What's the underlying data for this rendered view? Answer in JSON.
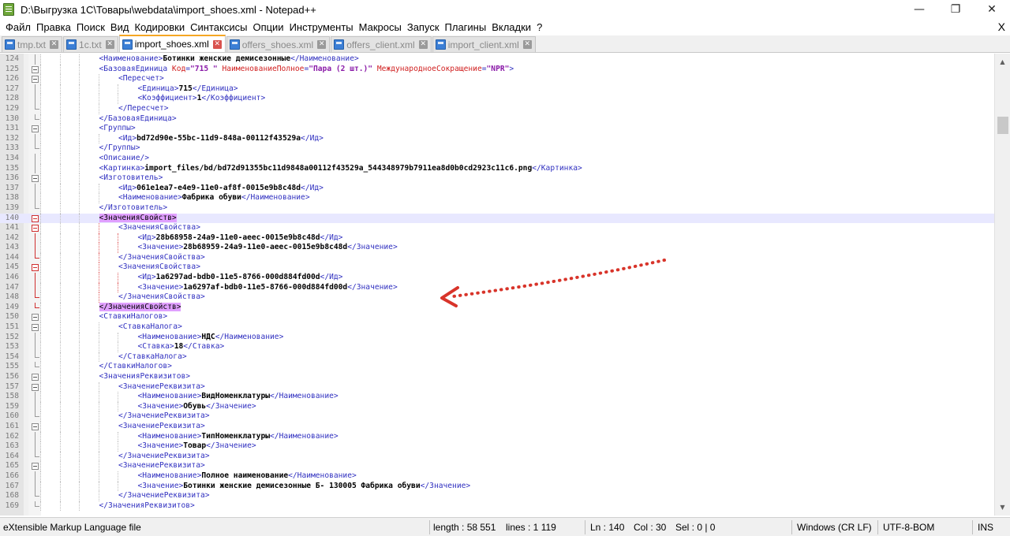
{
  "window": {
    "title": "D:\\Выгрузка 1С\\Товары\\webdata\\import_shoes.xml - Notepad++",
    "minimize": "—",
    "maximize": "❐",
    "close": "✕"
  },
  "menu": {
    "items": [
      "Файл",
      "Правка",
      "Поиск",
      "Вид",
      "Кодировки",
      "Синтаксисы",
      "Опции",
      "Инструменты",
      "Макросы",
      "Запуск",
      "Плагины",
      "Вкладки",
      "?"
    ],
    "close": "X"
  },
  "tabs": [
    {
      "label": "tmp.txt",
      "active": false
    },
    {
      "label": "1c.txt",
      "active": false
    },
    {
      "label": "import_shoes.xml",
      "active": true
    },
    {
      "label": "offers_shoes.xml",
      "active": false
    },
    {
      "label": "offers_client.xml",
      "active": false
    },
    {
      "label": "import_client.xml",
      "active": false
    }
  ],
  "editor": {
    "current_line": 140,
    "lines": [
      {
        "n": "124",
        "level": 4,
        "fold": "line",
        "parts": [
          [
            "tag",
            "<Наименование>"
          ],
          [
            "txt",
            "Ботинки женские демисезонные"
          ],
          [
            "tag",
            "</Наименование>"
          ]
        ]
      },
      {
        "n": "125",
        "level": 4,
        "fold": "box",
        "parts": [
          [
            "tag",
            "<БазоваяЕдиница "
          ],
          [
            "attr",
            "Код"
          ],
          [
            "tag",
            "="
          ],
          [
            "val",
            "\"715 \""
          ],
          [
            "tag",
            " "
          ],
          [
            "attr",
            "НаименованиеПолное"
          ],
          [
            "tag",
            "="
          ],
          [
            "val",
            "\"Пара (2 шт.)\""
          ],
          [
            "tag",
            " "
          ],
          [
            "attr",
            "МеждународноеСокращение"
          ],
          [
            "tag",
            "="
          ],
          [
            "val",
            "\"NPR\""
          ],
          [
            "tag",
            ">"
          ]
        ]
      },
      {
        "n": "126",
        "level": 5,
        "fold": "box",
        "parts": [
          [
            "tag",
            "<Пересчет>"
          ]
        ]
      },
      {
        "n": "127",
        "level": 6,
        "fold": "line",
        "parts": [
          [
            "tag",
            "<Единица>"
          ],
          [
            "txt",
            "715"
          ],
          [
            "tag",
            "</Единица>"
          ]
        ]
      },
      {
        "n": "128",
        "level": 6,
        "fold": "line",
        "parts": [
          [
            "tag",
            "<Коэффициент>"
          ],
          [
            "txt",
            "1"
          ],
          [
            "tag",
            "</Коэффициент>"
          ]
        ]
      },
      {
        "n": "129",
        "level": 5,
        "fold": "end",
        "parts": [
          [
            "tag",
            "</Пересчет>"
          ]
        ]
      },
      {
        "n": "130",
        "level": 4,
        "fold": "end",
        "parts": [
          [
            "tag",
            "</БазоваяЕдиница>"
          ]
        ]
      },
      {
        "n": "131",
        "level": 4,
        "fold": "box",
        "parts": [
          [
            "tag",
            "<Группы>"
          ]
        ]
      },
      {
        "n": "132",
        "level": 5,
        "fold": "line",
        "parts": [
          [
            "tag",
            "<Ид>"
          ],
          [
            "txt",
            "bd72d90e-55bc-11d9-848a-00112f43529a"
          ],
          [
            "tag",
            "</Ид>"
          ]
        ]
      },
      {
        "n": "133",
        "level": 4,
        "fold": "end",
        "parts": [
          [
            "tag",
            "</Группы>"
          ]
        ]
      },
      {
        "n": "134",
        "level": 4,
        "fold": "line",
        "parts": [
          [
            "tag",
            "<Описание/>"
          ]
        ]
      },
      {
        "n": "135",
        "level": 4,
        "fold": "line",
        "parts": [
          [
            "tag",
            "<Картинка>"
          ],
          [
            "txt",
            "import_files/bd/bd72d91355bc11d9848a00112f43529a_544348979b7911ea8d0b0cd2923c11c6.png"
          ],
          [
            "tag",
            "</Картинка>"
          ]
        ]
      },
      {
        "n": "136",
        "level": 4,
        "fold": "box",
        "parts": [
          [
            "tag",
            "<Изготовитель>"
          ]
        ]
      },
      {
        "n": "137",
        "level": 5,
        "fold": "line",
        "parts": [
          [
            "tag",
            "<Ид>"
          ],
          [
            "txt",
            "061e1ea7-e4e9-11e0-af8f-0015e9b8c48d"
          ],
          [
            "tag",
            "</Ид>"
          ]
        ]
      },
      {
        "n": "138",
        "level": 5,
        "fold": "line",
        "parts": [
          [
            "tag",
            "<Наименование>"
          ],
          [
            "txt",
            "Фабрика обуви"
          ],
          [
            "tag",
            "</Наименование>"
          ]
        ]
      },
      {
        "n": "139",
        "level": 4,
        "fold": "end",
        "parts": [
          [
            "tag",
            "</Изготовитель>"
          ]
        ]
      },
      {
        "n": "140",
        "level": 4,
        "fold": "box-red",
        "parts": [
          [
            "hl",
            "<ЗначенияСвойств>"
          ]
        ]
      },
      {
        "n": "141",
        "level": 5,
        "fold": "box-red",
        "parts": [
          [
            "tag",
            "<ЗначенияСвойства>"
          ]
        ]
      },
      {
        "n": "142",
        "level": 6,
        "fold": "line-red",
        "parts": [
          [
            "tag",
            "<Ид>"
          ],
          [
            "txt",
            "28b68958-24a9-11e0-aeec-0015e9b8c48d"
          ],
          [
            "tag",
            "</Ид>"
          ]
        ]
      },
      {
        "n": "143",
        "level": 6,
        "fold": "line-red",
        "parts": [
          [
            "tag",
            "<Значение>"
          ],
          [
            "txt",
            "28b68959-24a9-11e0-aeec-0015e9b8c48d"
          ],
          [
            "tag",
            "</Значение>"
          ]
        ]
      },
      {
        "n": "144",
        "level": 5,
        "fold": "end-red",
        "parts": [
          [
            "tag",
            "</ЗначенияСвойства>"
          ]
        ]
      },
      {
        "n": "145",
        "level": 5,
        "fold": "box-red",
        "parts": [
          [
            "tag",
            "<ЗначенияСвойства>"
          ]
        ]
      },
      {
        "n": "146",
        "level": 6,
        "fold": "line-red",
        "parts": [
          [
            "tag",
            "<Ид>"
          ],
          [
            "txt",
            "1a6297ad-bdb0-11e5-8766-000d884fd00d"
          ],
          [
            "tag",
            "</Ид>"
          ]
        ]
      },
      {
        "n": "147",
        "level": 6,
        "fold": "line-red",
        "parts": [
          [
            "tag",
            "<Значение>"
          ],
          [
            "txt",
            "1a6297af-bdb0-11e5-8766-000d884fd00d"
          ],
          [
            "tag",
            "</Значение>"
          ]
        ]
      },
      {
        "n": "148",
        "level": 5,
        "fold": "end-red",
        "parts": [
          [
            "tag",
            "</ЗначенияСвойства>"
          ]
        ]
      },
      {
        "n": "149",
        "level": 4,
        "fold": "end-red",
        "parts": [
          [
            "hl",
            "</ЗначенияСвойств>"
          ]
        ]
      },
      {
        "n": "150",
        "level": 4,
        "fold": "box",
        "parts": [
          [
            "tag",
            "<СтавкиНалогов>"
          ]
        ]
      },
      {
        "n": "151",
        "level": 5,
        "fold": "box",
        "parts": [
          [
            "tag",
            "<СтавкаНалога>"
          ]
        ]
      },
      {
        "n": "152",
        "level": 6,
        "fold": "line",
        "parts": [
          [
            "tag",
            "<Наименование>"
          ],
          [
            "txt",
            "НДС"
          ],
          [
            "tag",
            "</Наименование>"
          ]
        ]
      },
      {
        "n": "153",
        "level": 6,
        "fold": "line",
        "parts": [
          [
            "tag",
            "<Ставка>"
          ],
          [
            "txt",
            "18"
          ],
          [
            "tag",
            "</Ставка>"
          ]
        ]
      },
      {
        "n": "154",
        "level": 5,
        "fold": "end",
        "parts": [
          [
            "tag",
            "</СтавкаНалога>"
          ]
        ]
      },
      {
        "n": "155",
        "level": 4,
        "fold": "end",
        "parts": [
          [
            "tag",
            "</СтавкиНалогов>"
          ]
        ]
      },
      {
        "n": "156",
        "level": 4,
        "fold": "box",
        "parts": [
          [
            "tag",
            "<ЗначенияРеквизитов>"
          ]
        ]
      },
      {
        "n": "157",
        "level": 5,
        "fold": "box",
        "parts": [
          [
            "tag",
            "<ЗначениеРеквизита>"
          ]
        ]
      },
      {
        "n": "158",
        "level": 6,
        "fold": "line",
        "parts": [
          [
            "tag",
            "<Наименование>"
          ],
          [
            "txt",
            "ВидНоменклатуры"
          ],
          [
            "tag",
            "</Наименование>"
          ]
        ]
      },
      {
        "n": "159",
        "level": 6,
        "fold": "line",
        "parts": [
          [
            "tag",
            "<Значение>"
          ],
          [
            "txt",
            "Обувь"
          ],
          [
            "tag",
            "</Значение>"
          ]
        ]
      },
      {
        "n": "160",
        "level": 5,
        "fold": "end",
        "parts": [
          [
            "tag",
            "</ЗначениеРеквизита>"
          ]
        ]
      },
      {
        "n": "161",
        "level": 5,
        "fold": "box",
        "parts": [
          [
            "tag",
            "<ЗначениеРеквизита>"
          ]
        ]
      },
      {
        "n": "162",
        "level": 6,
        "fold": "line",
        "parts": [
          [
            "tag",
            "<Наименование>"
          ],
          [
            "txt",
            "ТипНоменклатуры"
          ],
          [
            "tag",
            "</Наименование>"
          ]
        ]
      },
      {
        "n": "163",
        "level": 6,
        "fold": "line",
        "parts": [
          [
            "tag",
            "<Значение>"
          ],
          [
            "txt",
            "Товар"
          ],
          [
            "tag",
            "</Значение>"
          ]
        ]
      },
      {
        "n": "164",
        "level": 5,
        "fold": "end",
        "parts": [
          [
            "tag",
            "</ЗначениеРеквизита>"
          ]
        ]
      },
      {
        "n": "165",
        "level": 5,
        "fold": "box",
        "parts": [
          [
            "tag",
            "<ЗначениеРеквизита>"
          ]
        ]
      },
      {
        "n": "166",
        "level": 6,
        "fold": "line",
        "parts": [
          [
            "tag",
            "<Наименование>"
          ],
          [
            "txt",
            "Полное наименование"
          ],
          [
            "tag",
            "</Наименование>"
          ]
        ]
      },
      {
        "n": "167",
        "level": 6,
        "fold": "line",
        "parts": [
          [
            "tag",
            "<Значение>"
          ],
          [
            "txt",
            "Ботинки женские демисезонные Б- 130005 Фабрика обуви"
          ],
          [
            "tag",
            "</Значение>"
          ]
        ]
      },
      {
        "n": "168",
        "level": 5,
        "fold": "end",
        "parts": [
          [
            "tag",
            "</ЗначениеРеквизита>"
          ]
        ]
      },
      {
        "n": "169",
        "level": 4,
        "fold": "end",
        "parts": [
          [
            "tag",
            "</ЗначенияРеквизитов>"
          ]
        ]
      }
    ]
  },
  "scrollbar": {
    "up": "▲",
    "down": "▼"
  },
  "status": {
    "filetype": "eXtensible Markup Language file",
    "length": "length : 58 551",
    "lines": "lines : 1 119",
    "ln": "Ln : 140",
    "col": "Col : 30",
    "sel": "Sel : 0 | 0",
    "eol": "Windows (CR LF)",
    "encoding": "UTF-8-BOM",
    "mode": "INS"
  },
  "colors": {
    "tag": "#3030c0",
    "attribute": "#d02020",
    "attr_value": "#8a1aa8",
    "text": "#000000",
    "match_highlight": "#e0a0ff",
    "current_line": "#e8e8ff",
    "annotation": "#d8342a"
  }
}
